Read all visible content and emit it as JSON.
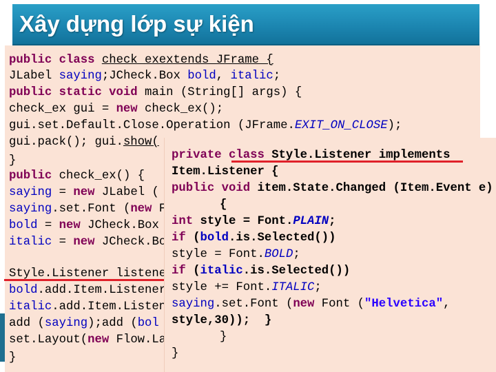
{
  "slide": {
    "title": "Xây dựng lớp sự kiện"
  },
  "main_code": {
    "l1a": "public",
    "l1b": " class ",
    "l1c": "check_exextends JFrame {",
    "l2a": "JLabel ",
    "l2b": "saying",
    "l2c": ";JCheck.Box ",
    "l2d": "bold",
    "l2e": ", ",
    "l2f": "italic",
    "l2g": ";",
    "l3a": "public static void",
    "l3b": " main (String[] args) {",
    "l4a": "check_ex gui = ",
    "l4b": "new",
    "l4c": " check_ex();",
    "l5a": "gui.set.Default.Close.Operation (JFrame.",
    "l5b": "EXIT_ON_CLOSE",
    "l5c": ");",
    "l6a": "gui.pack(); gui.",
    "l6b": "show(",
    "l7": "}",
    "l8a": "public",
    "l8b": " check_ex() {",
    "l9a": "saying",
    "l9b": " = ",
    "l9c": "new",
    "l9d": " JLabel (",
    "l10a": "saying",
    "l10b": ".set.Font (",
    "l10c": "new",
    "l10d": " F",
    "l11a": "bold",
    "l11b": " = ",
    "l11c": "new",
    "l11d": " JCheck.Box",
    "l12a": "italic",
    "l12b": " = ",
    "l12c": "new",
    "l12d": " JCheck.Bo",
    "l13": "Style.Listener listene",
    "l14a": "bold",
    "l14b": ".add.Item.Listener",
    "l15a": "italic",
    "l15b": ".add.Item.Listene",
    "l16a": "add (",
    "l16b": "saying",
    "l16c": ");add (",
    "l16d": "bol",
    "l17a": "set.Layout(",
    "l17b": "new",
    "l17c": " Flow.Lay",
    "l18": "}"
  },
  "popup_code": {
    "p1a": "private class ",
    "p1b": "Style.Listener implements",
    "p2": "Item.Listener {",
    "p3a": "public void",
    "p3b": " item.State.Changed (Item.Event e)",
    "p4": "{",
    "p5a": "int",
    "p5b": " style = Font.",
    "p5c": "PLAIN",
    "p5d": ";",
    "p6a": "if",
    "p6b": " (",
    "p6c": "bold",
    "p6d": ".is.Selected())",
    "p7a": "style = Font.",
    "p7b": "BOLD",
    "p7c": ";",
    "p8a": "if",
    "p8b": " (",
    "p8c": "italic",
    "p8d": ".is.Selected())",
    "p9a": "style += Font.",
    "p9b": "ITALIC",
    "p9c": ";",
    "p10a": "saying",
    "p10b": ".set.Font (",
    "p10c": "new",
    "p10d": " Font (",
    "p10e": "\"Helvetica\"",
    "p10f": ",",
    "p11": "style,30));  }",
    "p12": "}",
    "p13": "}"
  },
  "colors": {
    "title_bar": "#1c86b1",
    "panel_bg": "#fbe3d6",
    "keyword": "#7f0055",
    "field": "#0000c0",
    "string": "#2a00ff",
    "annotation_line": "#e0202a"
  }
}
